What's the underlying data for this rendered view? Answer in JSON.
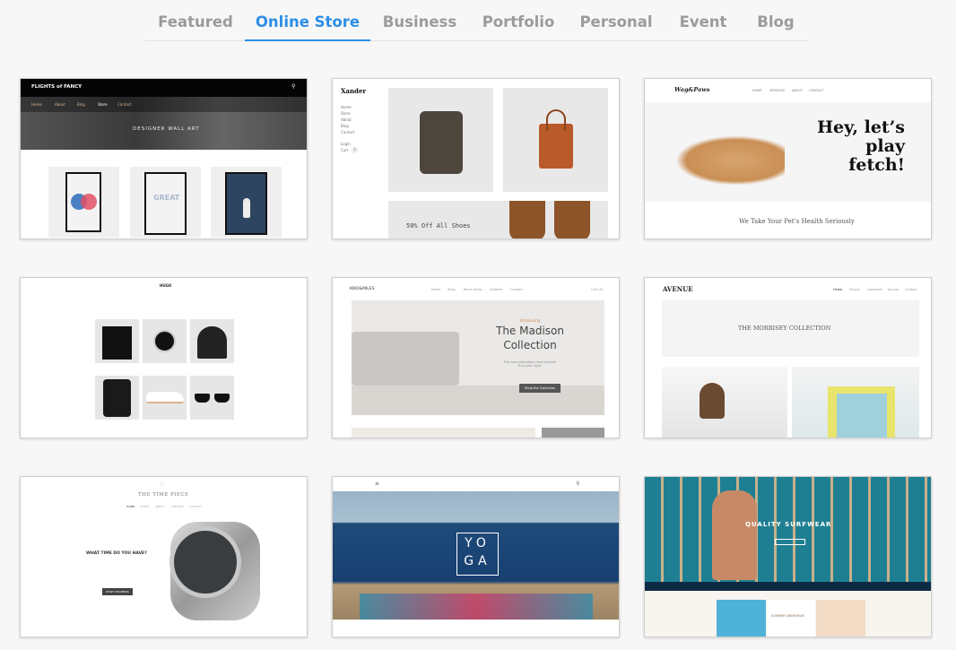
{
  "tabs": [
    {
      "label": "Featured"
    },
    {
      "label": "Online Store",
      "active": true
    },
    {
      "label": "Business"
    },
    {
      "label": "Portfolio"
    },
    {
      "label": "Personal"
    },
    {
      "label": "Event"
    },
    {
      "label": "Blog"
    }
  ],
  "accent": "#2d8ee6",
  "templates": {
    "flights": {
      "logo": "FLIGHTS of FANCY",
      "nav": [
        "Home",
        "About",
        "Blog",
        "Store",
        "Contact"
      ],
      "hero": "DESIGNER WALL ART",
      "poster_text": "GREAT"
    },
    "xander": {
      "logo": "Xander",
      "nav": [
        "Home",
        "Store",
        "About",
        "Blog",
        "Contact"
      ],
      "login": "Login",
      "cart": "Cart",
      "cart_count": "1",
      "banner": "50% Off All Shoes"
    },
    "wag": {
      "logo": "Wag&Paws",
      "nav": [
        "HOME",
        "SERVICES",
        "ABOUT",
        "CONTACT"
      ],
      "hero": "Hey, let’s play fetch!",
      "subtitle": "We Take Your Pet’s Health Seriously"
    },
    "hugo": {
      "logo": "HUGO"
    },
    "kiko": {
      "logo": "KIKO&MILES",
      "nav": [
        "Home",
        "Shop",
        "Room Ideas",
        "Updates",
        "Contact"
      ],
      "cart": "Cart (0)",
      "eyebrow": "Introducing",
      "title": "The Madison Collection",
      "text": "The new collections have arrived. Find your style.",
      "button": "Shop the Collection"
    },
    "avenue": {
      "logo": "AVENUE",
      "nav": [
        "Home",
        "Shop ▾",
        "Lookbook",
        "Journal",
        "Contact"
      ],
      "hero": "THE MORRISEY COLLECTION"
    },
    "timepiece": {
      "logo": "THE TIME PIECE",
      "nav": [
        "HOME",
        "STORE",
        "ABOUT",
        "UPDATES",
        "CONTACT"
      ],
      "headline": "WHAT TIME DO YOU HAVE?",
      "button": "START SHOPPING"
    },
    "yoga": {
      "hero": "YOGA"
    },
    "surf": {
      "hero": "QUALITY SURFWEAR",
      "section": "SUMMER SWIMWEAR"
    }
  }
}
